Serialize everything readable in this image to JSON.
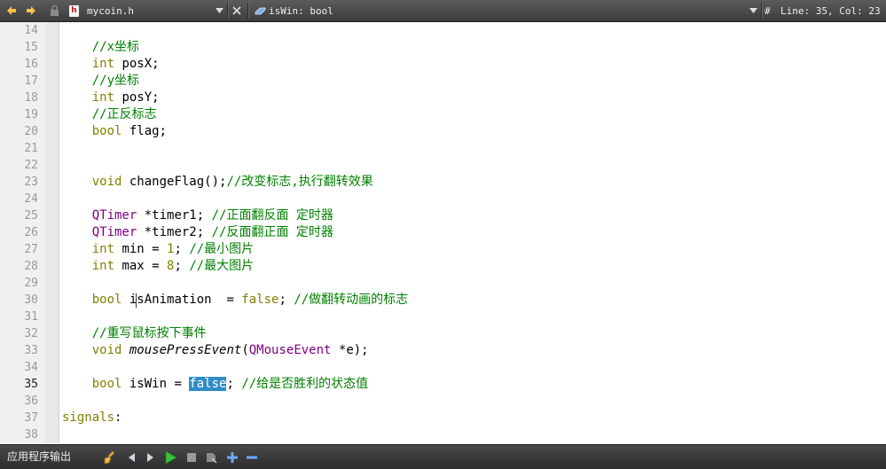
{
  "toolbar": {
    "file_name": "mycoin.h",
    "file_badge": "h",
    "symbol": "isWin: bool",
    "hash": "#",
    "position": "Line: 35, Col: 23"
  },
  "editor": {
    "current_line": "35",
    "lines": [
      {
        "n": "14",
        "tokens": []
      },
      {
        "n": "15",
        "tokens": [
          {
            "t": "    "
          },
          {
            "t": "//x坐标",
            "c": "c"
          }
        ]
      },
      {
        "n": "16",
        "tokens": [
          {
            "t": "    "
          },
          {
            "t": "int",
            "c": "type"
          },
          {
            "t": " posX;"
          }
        ]
      },
      {
        "n": "17",
        "tokens": [
          {
            "t": "    "
          },
          {
            "t": "//y坐标",
            "c": "c"
          }
        ]
      },
      {
        "n": "18",
        "tokens": [
          {
            "t": "    "
          },
          {
            "t": "int",
            "c": "type"
          },
          {
            "t": " posY;"
          }
        ]
      },
      {
        "n": "19",
        "tokens": [
          {
            "t": "    "
          },
          {
            "t": "//正反标志",
            "c": "c"
          }
        ]
      },
      {
        "n": "20",
        "tokens": [
          {
            "t": "    "
          },
          {
            "t": "bool",
            "c": "type"
          },
          {
            "t": " flag;"
          }
        ]
      },
      {
        "n": "21",
        "tokens": []
      },
      {
        "n": "22",
        "tokens": []
      },
      {
        "n": "23",
        "tokens": [
          {
            "t": "    "
          },
          {
            "t": "void",
            "c": "type"
          },
          {
            "t": " changeFlag();"
          },
          {
            "t": "//改变标志,执行翻转效果",
            "c": "c"
          }
        ]
      },
      {
        "n": "24",
        "tokens": []
      },
      {
        "n": "25",
        "tokens": [
          {
            "t": "    "
          },
          {
            "t": "QTimer",
            "c": "qt"
          },
          {
            "t": " *timer1; "
          },
          {
            "t": "//正面翻反面 定时器",
            "c": "c"
          }
        ]
      },
      {
        "n": "26",
        "tokens": [
          {
            "t": "    "
          },
          {
            "t": "QTimer",
            "c": "qt"
          },
          {
            "t": " *timer2; "
          },
          {
            "t": "//反面翻正面 定时器",
            "c": "c"
          }
        ]
      },
      {
        "n": "27",
        "tokens": [
          {
            "t": "    "
          },
          {
            "t": "int",
            "c": "type"
          },
          {
            "t": " min = "
          },
          {
            "t": "1",
            "c": "kw"
          },
          {
            "t": "; "
          },
          {
            "t": "//最小图片",
            "c": "c"
          }
        ]
      },
      {
        "n": "28",
        "tokens": [
          {
            "t": "    "
          },
          {
            "t": "int",
            "c": "type"
          },
          {
            "t": " max = "
          },
          {
            "t": "8",
            "c": "kw"
          },
          {
            "t": "; "
          },
          {
            "t": "//最大图片",
            "c": "c"
          }
        ]
      },
      {
        "n": "29",
        "tokens": []
      },
      {
        "n": "30",
        "tokens": [
          {
            "t": "    "
          },
          {
            "t": "bool",
            "c": "type"
          },
          {
            "t": " isAnimation  = "
          },
          {
            "t": "false",
            "c": "kw"
          },
          {
            "t": "; "
          },
          {
            "t": "//做翻转动画的标志",
            "c": "c"
          }
        ]
      },
      {
        "n": "31",
        "tokens": []
      },
      {
        "n": "32",
        "tokens": [
          {
            "t": "    "
          },
          {
            "t": "//重写鼠标按下事件",
            "c": "c"
          }
        ]
      },
      {
        "n": "33",
        "tokens": [
          {
            "t": "    "
          },
          {
            "t": "void",
            "c": "type"
          },
          {
            "t": " "
          },
          {
            "t": "mousePressEvent",
            "c": "fn"
          },
          {
            "t": "("
          },
          {
            "t": "QMouseEvent",
            "c": "qt"
          },
          {
            "t": " *e);"
          }
        ]
      },
      {
        "n": "34",
        "tokens": []
      },
      {
        "n": "35",
        "tokens": [
          {
            "t": "    "
          },
          {
            "t": "bool",
            "c": "type"
          },
          {
            "t": " isWin = "
          },
          {
            "t": "false",
            "c": "sel"
          },
          {
            "t": "; "
          },
          {
            "t": "//给是否胜利的状态值",
            "c": "c"
          }
        ]
      },
      {
        "n": "36",
        "tokens": []
      },
      {
        "n": "37",
        "tokens": [
          {
            "t": "signals",
            "c": "kw"
          },
          {
            "t": ":"
          }
        ]
      },
      {
        "n": "38",
        "tokens": []
      }
    ]
  },
  "output": {
    "label": "应用程序输出"
  },
  "colors": {
    "type": "#808000",
    "qt_class": "#800080",
    "comment": "#008000",
    "selection": "#308cc6",
    "run_green": "#3fc23f"
  }
}
